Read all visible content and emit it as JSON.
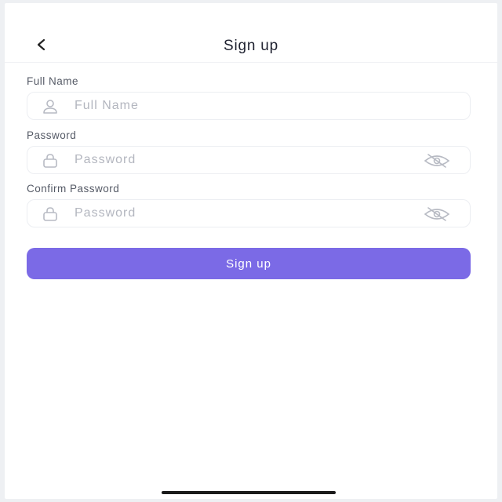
{
  "header": {
    "title": "Sign up",
    "back_icon": "chevron-left-icon"
  },
  "form": {
    "full_name": {
      "label": "Full Name",
      "placeholder": "Full Name",
      "value": "",
      "icon": "user-icon"
    },
    "password": {
      "label": "Password",
      "placeholder": "Password",
      "value": "",
      "icon": "lock-icon",
      "toggle_icon": "eye-off-icon"
    },
    "confirm_password": {
      "label": "Confirm Password",
      "placeholder": "Password",
      "value": "",
      "icon": "lock-icon",
      "toggle_icon": "eye-off-icon"
    },
    "submit_label": "Sign up"
  },
  "colors": {
    "accent": "#7b6ae6",
    "placeholder": "#b3b6bf",
    "label": "#555a66"
  }
}
